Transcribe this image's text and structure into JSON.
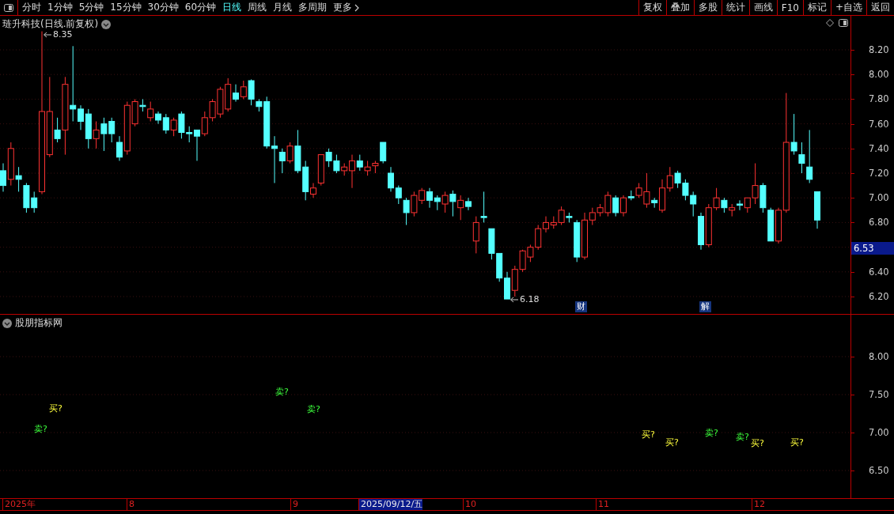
{
  "toolbar": {
    "period_tabs": [
      {
        "label": "分时",
        "selected": false
      },
      {
        "label": "1分钟",
        "selected": false
      },
      {
        "label": "5分钟",
        "selected": false
      },
      {
        "label": "15分钟",
        "selected": false
      },
      {
        "label": "30分钟",
        "selected": false
      },
      {
        "label": "60分钟",
        "selected": false
      },
      {
        "label": "日线",
        "selected": true
      },
      {
        "label": "周线",
        "selected": false
      },
      {
        "label": "月线",
        "selected": false
      },
      {
        "label": "多周期",
        "selected": false
      },
      {
        "label": "更多",
        "selected": false
      }
    ],
    "actions": [
      "复权",
      "叠加",
      "多股",
      "统计",
      "画线",
      "F10",
      "标记",
      "+自选",
      "返回"
    ]
  },
  "main_chart": {
    "title": "琏升科技(日线.前复权)",
    "price_axis": [
      "8.20",
      "8.00",
      "7.80",
      "7.60",
      "7.40",
      "7.20",
      "7.00",
      "6.80",
      "6.40",
      "6.20"
    ],
    "high_label": "8.35",
    "low_label": "6.18",
    "current_price": "6.53",
    "event_marks": [
      "财",
      "解"
    ]
  },
  "indicator": {
    "title": "股朋指标网",
    "axis": [
      "8.00",
      "7.50",
      "7.00",
      "6.50"
    ],
    "signals": [
      {
        "kind": "sell",
        "text": "卖?"
      },
      {
        "kind": "buy",
        "text": "买?"
      },
      {
        "kind": "sell",
        "text": "卖?"
      },
      {
        "kind": "sell",
        "text": "卖?"
      },
      {
        "kind": "buy",
        "text": "买?"
      },
      {
        "kind": "buy",
        "text": "买?"
      },
      {
        "kind": "sell",
        "text": "卖?"
      },
      {
        "kind": "sell",
        "text": "卖?"
      },
      {
        "kind": "buy",
        "text": "买?"
      },
      {
        "kind": "buy",
        "text": "买?"
      }
    ]
  },
  "time_axis": [
    {
      "label": "2025年",
      "selected": false
    },
    {
      "label": "8",
      "selected": false
    },
    {
      "label": "9",
      "selected": false
    },
    {
      "label": "2025/09/12/五",
      "selected": true
    },
    {
      "label": "10",
      "selected": false
    },
    {
      "label": "11",
      "selected": false
    },
    {
      "label": "12",
      "selected": false
    }
  ]
}
